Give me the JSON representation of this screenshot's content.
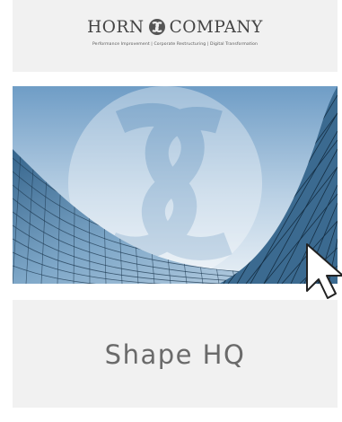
{
  "header": {
    "brand_left": "HORN",
    "brand_right": "COMPANY",
    "logo_icon": "horn-company-knot-icon",
    "tagline": "Performance Improvement | Corporate Restructuring | Digital Transformation"
  },
  "hero": {
    "image": "skyscraper-glass-facade-photo",
    "watermark": "horn-company-knot-watermark"
  },
  "card": {
    "title": "Shape HQ"
  },
  "cursor": {
    "icon": "mouse-pointer-icon"
  },
  "colors": {
    "panel_background": "#f1f1f1",
    "text_gray": "#6a6a6a",
    "sky_blue": "#6f9dc6"
  }
}
